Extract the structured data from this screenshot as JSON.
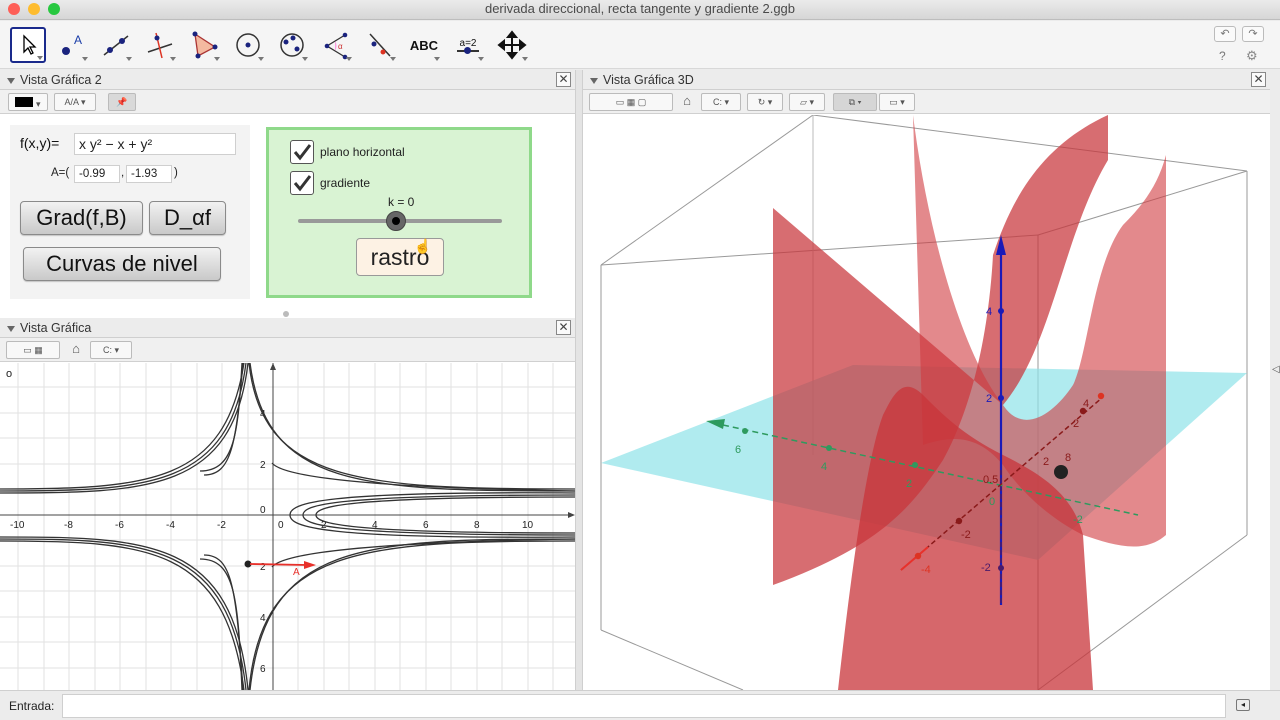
{
  "window": {
    "title": "derivada direccional, recta tangente y gradiente 2.ggb",
    "traffic_colors": [
      "#fe5f57",
      "#febc2e",
      "#28c840"
    ]
  },
  "toolbar": {
    "tools": [
      {
        "name": "move-tool-icon",
        "selected": true
      },
      {
        "name": "point-tool-icon",
        "selected": false
      },
      {
        "name": "line-tool-icon",
        "selected": false
      },
      {
        "name": "perpendicular-tool-icon",
        "selected": false
      },
      {
        "name": "polygon-tool-icon",
        "selected": false
      },
      {
        "name": "circle-tool-icon",
        "selected": false
      },
      {
        "name": "conic-tool-icon",
        "selected": false
      },
      {
        "name": "angle-tool-icon",
        "selected": false
      },
      {
        "name": "reflect-tool-icon",
        "selected": false
      },
      {
        "name": "text-tool-icon",
        "label": "ABC",
        "selected": false
      },
      {
        "name": "slider-tool-icon",
        "label": "a=2",
        "selected": false
      },
      {
        "name": "move-view-tool-icon",
        "selected": false
      }
    ],
    "undo_icon": "undo-icon",
    "redo_icon": "redo-icon",
    "help_label": "?",
    "settings_icon": "gear-icon"
  },
  "graphics2": {
    "title": "Vista Gráfica 2",
    "close_label": "✕",
    "style_aa_label": "A/A",
    "function_label": "f(x,y)=",
    "function_value": "x y² − x + y²",
    "point_label": "A=(",
    "point_x": "-0.99",
    "point_sep": ",",
    "point_y": "-1.93",
    "point_close": ")",
    "btn_grad": "Grad(f,B)",
    "btn_dalpha": "D_αf",
    "btn_curvas": "Curvas de nivel",
    "chk_plano": "plano horizontal",
    "chk_gradiente": "gradiente",
    "slider_label": "k = 0",
    "slider_value": 0.48,
    "btn_rastro": "rastro",
    "panel_bg": "#d9f3d3",
    "panel_border": "#8fd98a"
  },
  "graphics1": {
    "title": "Vista Gráfica",
    "close_label": "✕",
    "corner_label": "o",
    "x_ticks": [
      "-10",
      "-8",
      "-6",
      "-4",
      "-2",
      "0",
      "2",
      "4",
      "6",
      "8",
      "10"
    ],
    "y_ticks_pos": [
      "4",
      "2"
    ],
    "y_ticks_neg": [
      "2",
      "4",
      "6"
    ],
    "origin_label": "0",
    "point_label": "A",
    "grad_color": "#e8312b"
  },
  "graphics3d": {
    "title": "Vista Gráfica 3D",
    "close_label": "✕",
    "axis_labels_z": [
      "4",
      "2",
      "-2"
    ],
    "axis_labels_y": [
      "6",
      "4",
      "2"
    ],
    "axis_labels_x": [
      "-4",
      "-2",
      "2",
      "4"
    ],
    "misc_labels": [
      "0",
      "-2",
      "2",
      "8",
      "0.5"
    ],
    "surface_color": "#c8343a",
    "plane_color": "#8fe3e8"
  },
  "input_bar": {
    "label": "Entrada:"
  }
}
